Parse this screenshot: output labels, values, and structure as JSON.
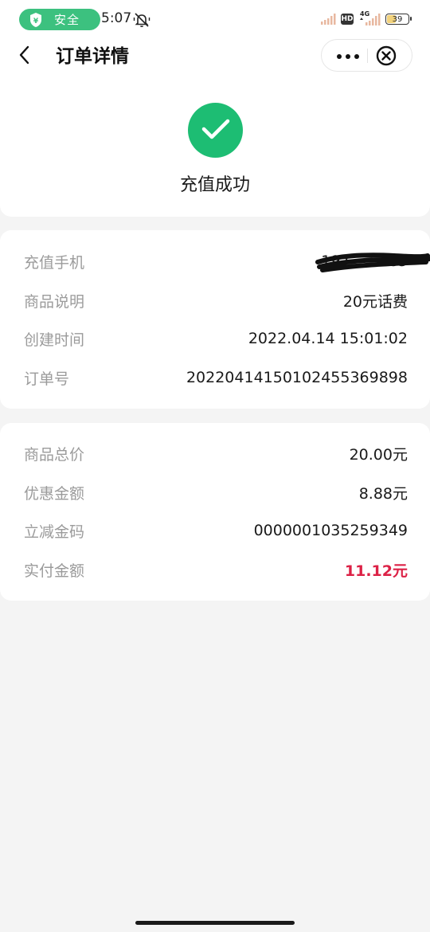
{
  "status_bar": {
    "safe_label": "安全",
    "time": "5:07",
    "hd_label": "HD",
    "network_label": "4G",
    "battery_level": "39"
  },
  "nav": {
    "title": "订单详情"
  },
  "result": {
    "status_text": "充值成功",
    "status_color": "#1dbd73"
  },
  "order_info": [
    {
      "label": "充值手机",
      "value": "197········85"
    },
    {
      "label": "商品说明",
      "value": "20元话费"
    },
    {
      "label": "创建时间",
      "value": "2022.04.14 15:01:02"
    },
    {
      "label": "订单号",
      "value": "20220414150102455369898"
    }
  ],
  "payment_info": [
    {
      "label": "商品总价",
      "value": "20.00元"
    },
    {
      "label": "优惠金额",
      "value": "8.88元"
    },
    {
      "label": "立减金码",
      "value": "0000001035259349"
    },
    {
      "label": "实付金额",
      "value": "11.12元"
    }
  ],
  "colors": {
    "accent_green": "#3cc17f",
    "paid_red": "#dc2146"
  },
  "icons": {
    "back": "chevron-left-icon",
    "more": "more-dots-icon",
    "close": "close-circle-icon",
    "success": "check-icon",
    "shield": "shield-icon",
    "bell": "bell-muted-icon"
  }
}
